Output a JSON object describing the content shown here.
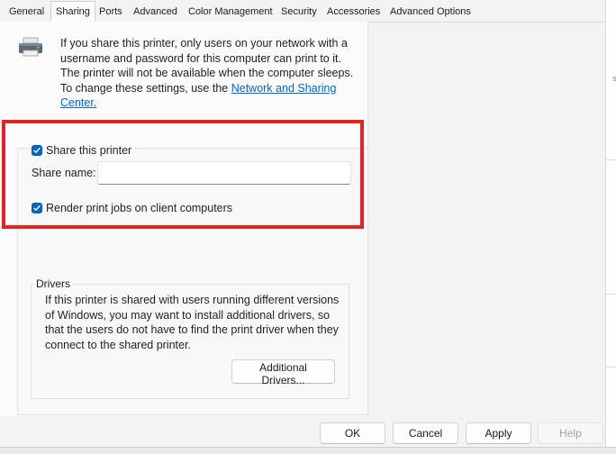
{
  "tabs": [
    {
      "label": "General"
    },
    {
      "label": "Sharing"
    },
    {
      "label": "Ports"
    },
    {
      "label": "Advanced"
    },
    {
      "label": "Color Management"
    },
    {
      "label": "Security"
    },
    {
      "label": "Accessories"
    },
    {
      "label": "Advanced Options"
    }
  ],
  "active_tab": "Sharing",
  "intro": {
    "text": "If you share this printer, only users on your network with a username and password for this computer can print to it. The printer will not be available when the computer sleeps. To change these settings, use the ",
    "link": "Network and Sharing Center."
  },
  "share": {
    "share_printer_label": "Share this printer",
    "share_printer_checked": true,
    "share_name_label": "Share name:",
    "share_name_value": "",
    "render_jobs_label": "Render print jobs on client computers",
    "render_jobs_checked": true
  },
  "drivers": {
    "title": "Drivers",
    "text": "If this printer is shared with users running different versions of Windows, you may want to install additional drivers, so that the users do not have to find the print driver when they connect to the shared printer.",
    "button": "Additional Drivers..."
  },
  "footer": {
    "ok": "OK",
    "cancel": "Cancel",
    "apply": "Apply",
    "help": "Help"
  },
  "background_window": {
    "fragment": "s"
  },
  "colors": {
    "accent": "#0067c0",
    "highlight": "#e02323"
  },
  "icons": [
    "printer-icon",
    "checkmark-icon"
  ]
}
